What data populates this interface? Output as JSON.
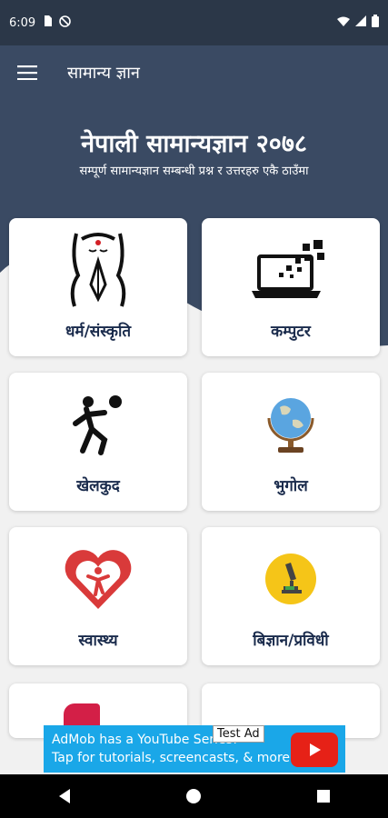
{
  "status_bar": {
    "time": "6:09"
  },
  "app_bar": {
    "title": "सामान्य ज्ञान"
  },
  "hero": {
    "title": "नेपाली सामान्यज्ञान २०७८",
    "subtitle": "सम्पूर्ण सामान्यज्ञान सम्बन्धी प्रश्न र उत्तरहरु एकै ठाउँमा"
  },
  "categories": [
    {
      "label": "धर्म/संस्कृति",
      "icon": "namaste-icon"
    },
    {
      "label": "कम्पुटर",
      "icon": "laptop-icon"
    },
    {
      "label": "खेलकुद",
      "icon": "player-ball-icon"
    },
    {
      "label": "भुगोल",
      "icon": "globe-icon"
    },
    {
      "label": "स्वास्थ्य",
      "icon": "heart-person-icon"
    },
    {
      "label": "बिज्ञान/प्रविधी",
      "icon": "microscope-icon"
    }
  ],
  "ad": {
    "line1": "AdMob has a YouTube Series!",
    "line2": "Tap for tutorials, screencasts, & more.",
    "tag": "Test Ad"
  },
  "colors": {
    "header": "#3a4a63",
    "status_bar": "#2b3748",
    "card_label": "#1a2b4c",
    "ad_background": "#1aa7e8"
  }
}
